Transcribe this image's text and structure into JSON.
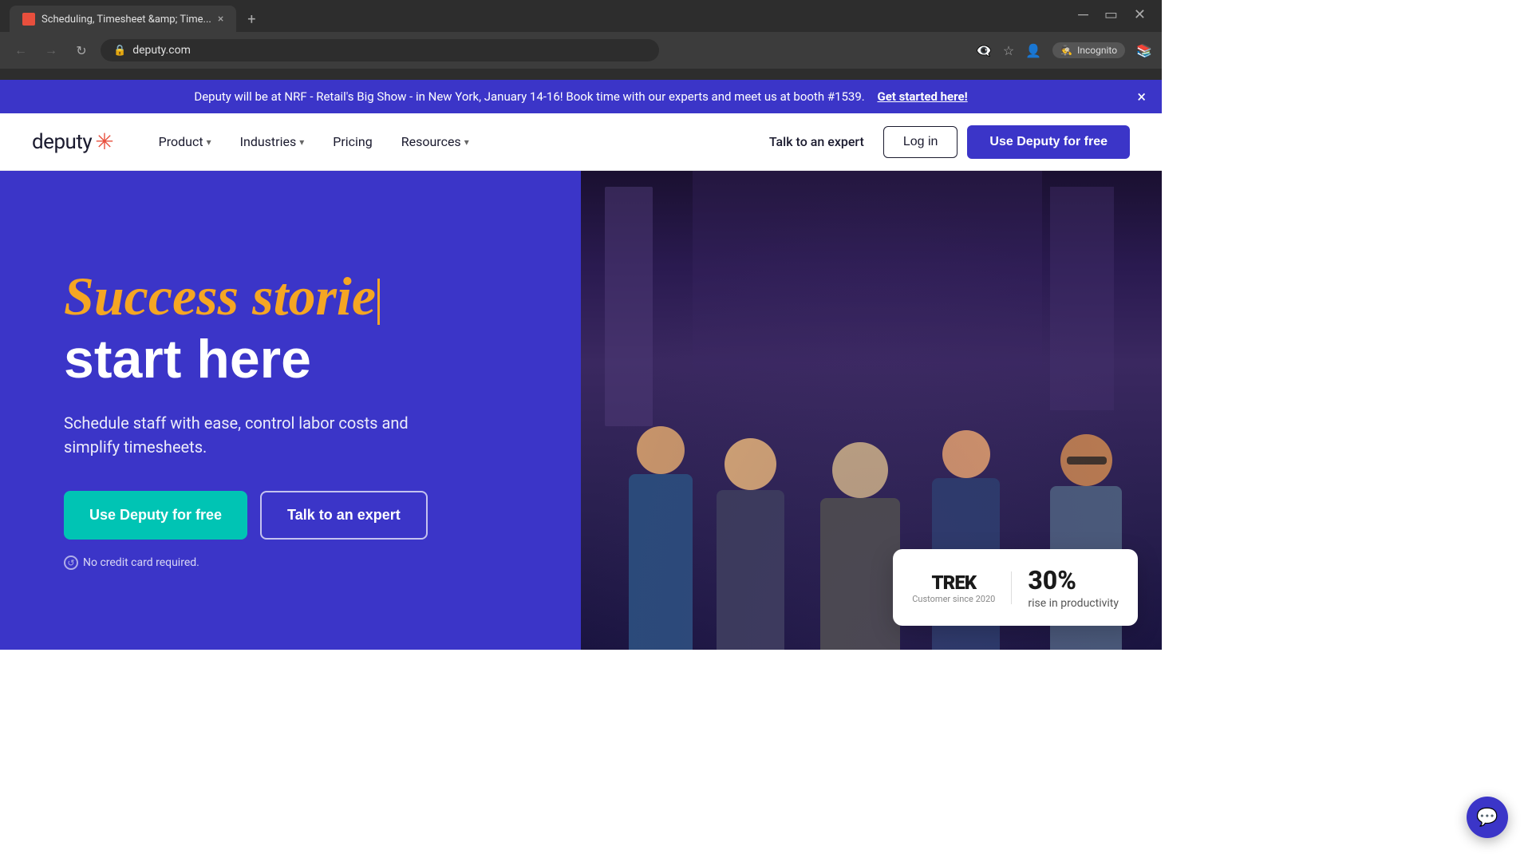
{
  "browser": {
    "tab_title": "Scheduling, Timesheet &amp; Time...",
    "tab_favicon": "S",
    "url": "deputy.com",
    "incognito_label": "Incognito"
  },
  "banner": {
    "text": "Deputy will be at NRF - Retail's Big Show - in New York, January 14-16! Book time with our experts and meet us at booth #1539.",
    "link_text": "Get started here!",
    "close_label": "×"
  },
  "nav": {
    "logo_text": "deputy",
    "product_label": "Product",
    "industries_label": "Industries",
    "pricing_label": "Pricing",
    "resources_label": "Resources",
    "talk_expert_label": "Talk to an expert",
    "login_label": "Log in",
    "cta_label": "Use Deputy for free"
  },
  "hero": {
    "headline_animated": "Success storie",
    "headline_static": "start here",
    "subtext": "Schedule staff with ease, control labor costs and simplify timesheets.",
    "btn_primary": "Use Deputy for free",
    "btn_secondary": "Talk to an expert",
    "no_credit_card": "No credit card required."
  },
  "trek_card": {
    "logo": "TREK",
    "since": "Customer since 2020",
    "percent": "30%",
    "label": "rise in productivity"
  },
  "colors": {
    "primary": "#3b35c8",
    "accent_orange": "#f5a623",
    "accent_teal": "#00c4b4",
    "red": "#e84f3d"
  }
}
